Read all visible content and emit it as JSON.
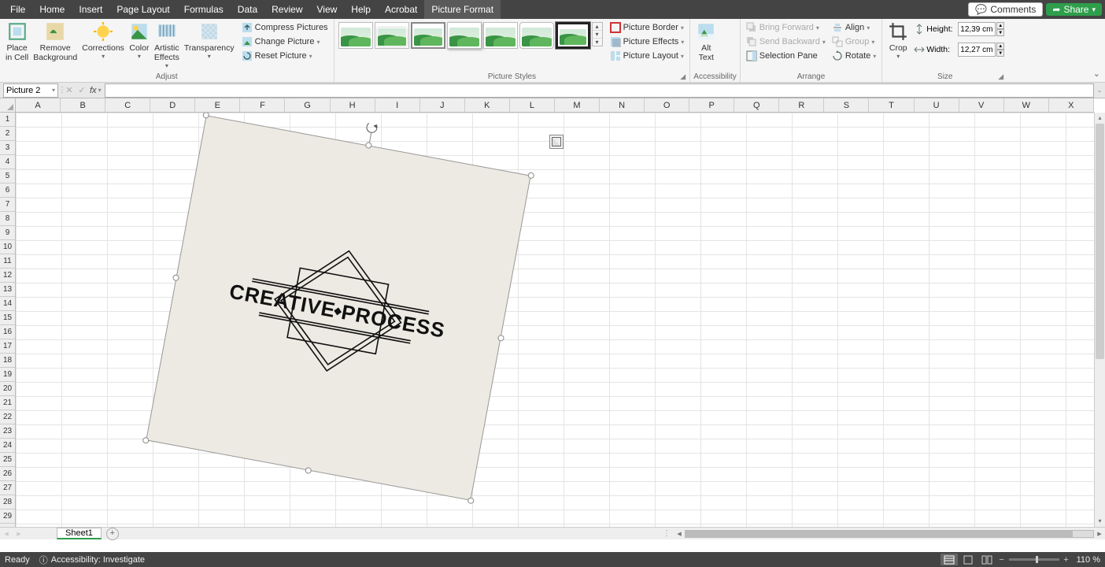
{
  "menu": {
    "tabs": [
      "File",
      "Home",
      "Insert",
      "Page Layout",
      "Formulas",
      "Data",
      "Review",
      "View",
      "Help",
      "Acrobat",
      "Picture Format"
    ],
    "active_index": 10
  },
  "titlebar": {
    "comments": "Comments",
    "share": "Share"
  },
  "ribbon": {
    "adjust": {
      "label": "Adjust",
      "place_in_cell": "Place\nin Cell",
      "remove_bg": "Remove\nBackground",
      "corrections": "Corrections",
      "color": "Color",
      "artistic": "Artistic\nEffects",
      "transparency": "Transparency",
      "compress": "Compress Pictures",
      "change": "Change Picture",
      "reset": "Reset Picture"
    },
    "styles": {
      "label": "Picture Styles",
      "border": "Picture Border",
      "effects": "Picture Effects",
      "layout": "Picture Layout"
    },
    "acc": {
      "label": "Accessibility",
      "alt": "Alt\nText"
    },
    "arrange": {
      "label": "Arrange",
      "forward": "Bring Forward",
      "backward": "Send Backward",
      "selpane": "Selection Pane",
      "align": "Align",
      "group": "Group",
      "rotate": "Rotate"
    },
    "size": {
      "label": "Size",
      "crop": "Crop",
      "height_lab": "Height:",
      "width_lab": "Width:",
      "height_val": "12,39 cm",
      "width_val": "12,27 cm"
    }
  },
  "fbar": {
    "namebox": "Picture 2",
    "formula": ""
  },
  "sheet": {
    "cols": [
      "A",
      "B",
      "C",
      "D",
      "E",
      "F",
      "G",
      "H",
      "I",
      "J",
      "K",
      "L",
      "M",
      "N",
      "O",
      "P",
      "Q",
      "R",
      "S",
      "T",
      "U",
      "V",
      "W",
      "X"
    ],
    "rows": [
      "1",
      "2",
      "3",
      "4",
      "5",
      "6",
      "7",
      "8",
      "9",
      "10",
      "11",
      "12",
      "13",
      "14",
      "15",
      "16",
      "17",
      "18",
      "19",
      "20",
      "21",
      "22",
      "23",
      "24",
      "25",
      "26",
      "27",
      "28",
      "29"
    ],
    "tab_name": "Sheet1",
    "picture_text1": "CREATIVE",
    "picture_text2": "PROCESS"
  },
  "status": {
    "ready": "Ready",
    "acc": "Accessibility: Investigate",
    "zoom": "110 %"
  }
}
